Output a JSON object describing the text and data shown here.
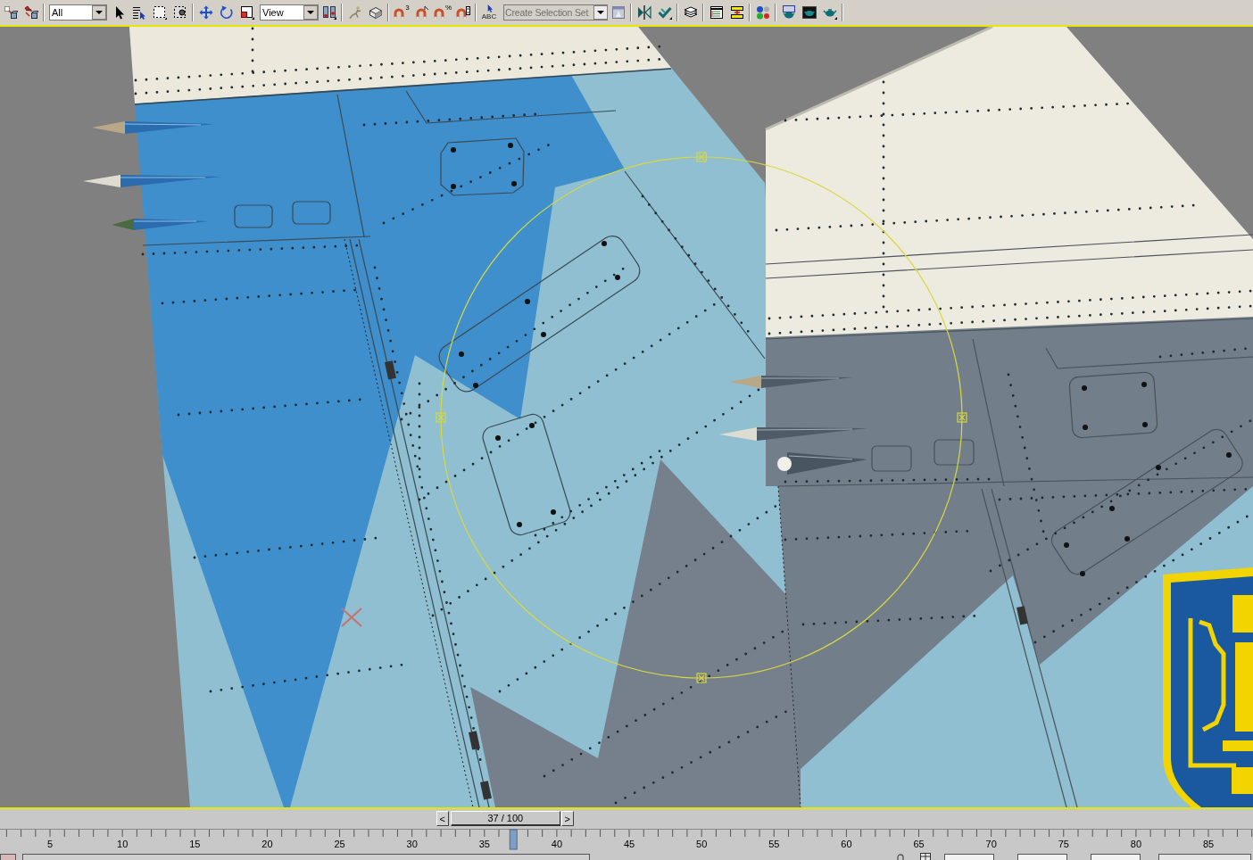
{
  "toolbar": {
    "selection_filter": {
      "value": "All"
    },
    "reference_coordinate_system": {
      "value": "View"
    },
    "snaps_toggle": {
      "badge": "3"
    },
    "percent_snap_toggle": {
      "badge": "%"
    },
    "edit_named_selection": {
      "badge": "ABC"
    },
    "named_selection_set": {
      "placeholder": "Create Selection Set"
    }
  },
  "time_slider": {
    "previous": "<",
    "label": "37 / 100",
    "next": ">",
    "level": 0.37
  },
  "track_bar": {
    "frame_labels": [
      "5",
      "10",
      "15",
      "20",
      "25",
      "30",
      "35",
      "40",
      "45",
      "50",
      "55",
      "60",
      "65",
      "70",
      "75",
      "80",
      "85"
    ]
  }
}
